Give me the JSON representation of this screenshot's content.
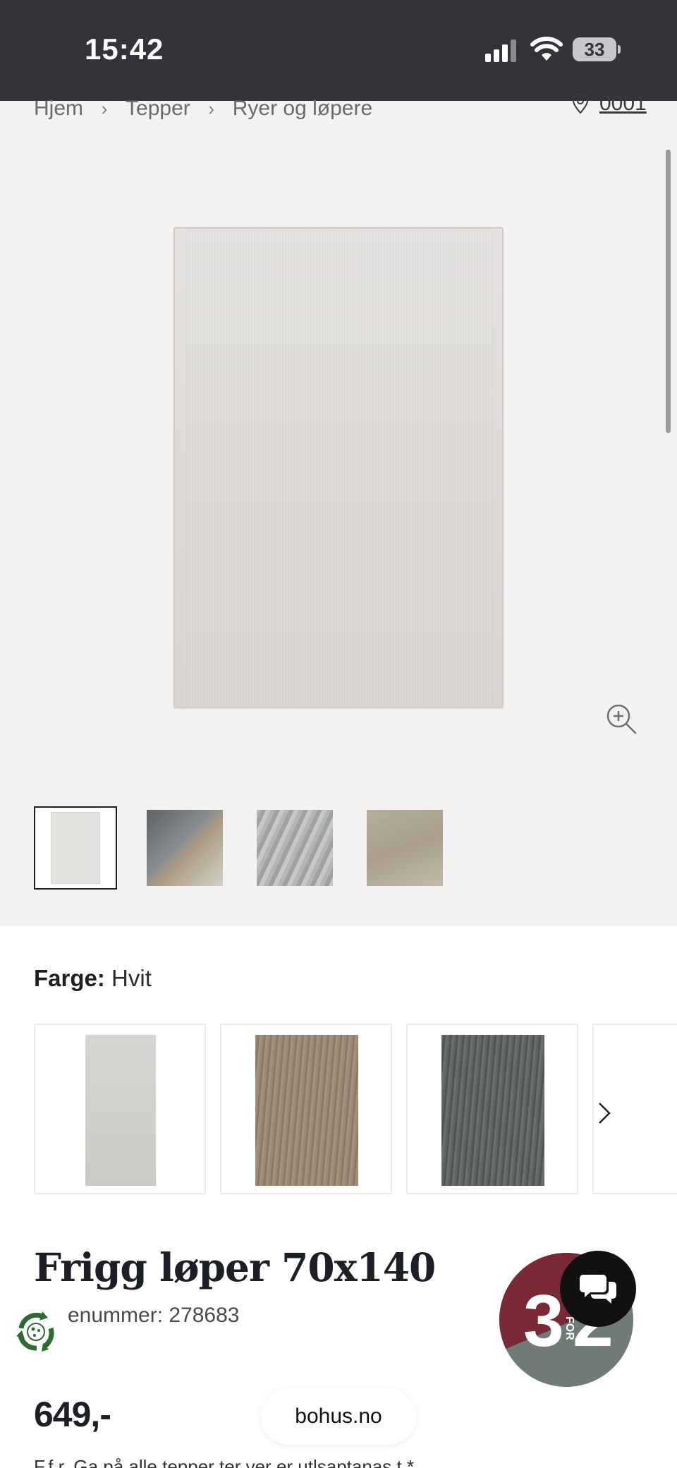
{
  "status_bar": {
    "time": "15:42",
    "battery": "33"
  },
  "breadcrumb": {
    "items": [
      "Hjem",
      "Tepper",
      "Ryer og løpere"
    ],
    "separator": "›"
  },
  "store": {
    "label": "0001",
    "icon": "location-pin-icon"
  },
  "gallery": {
    "thumbnail_count": 4,
    "active_thumbnail": 1,
    "zoom_icon": "zoom-in-icon"
  },
  "color_selector": {
    "label": "Farge:",
    "value": "Hvit",
    "options": [
      "Hvit",
      "Beige",
      "Grå"
    ],
    "next_icon": "chevron-right-icon"
  },
  "product": {
    "title": "Frigg løper 70x140",
    "article_number": "enummer: 278683",
    "price": "649,-"
  },
  "badge": {
    "text_big": "3",
    "text_small": "FOR",
    "text_big2": "2",
    "colors": {
      "top": "#7a2a34",
      "bottom": "#707a78"
    }
  },
  "url_pill": "bohus.no",
  "footer_cut": "F.f.r. Ga på alle tepper ter ver er utlsaptanas t.*"
}
